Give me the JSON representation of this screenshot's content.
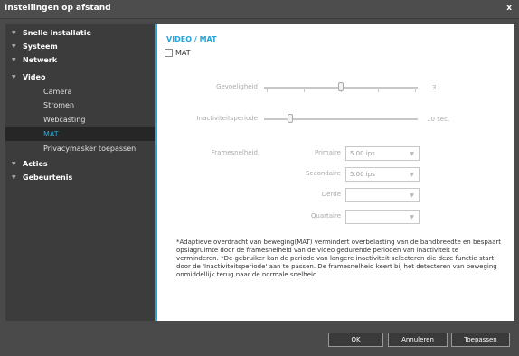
{
  "window": {
    "title": "Instellingen op afstand",
    "close": "x"
  },
  "sidebar": {
    "items": [
      {
        "label": "Snelle installatie",
        "arrow": "▼"
      },
      {
        "label": "Systeem",
        "arrow": "▼"
      },
      {
        "label": "Netwerk",
        "arrow": "▼"
      },
      {
        "label": "Video",
        "arrow": "▼"
      },
      {
        "label": "Camera"
      },
      {
        "label": "Stromen"
      },
      {
        "label": "Webcasting"
      },
      {
        "label": "MAT"
      },
      {
        "label": "Privacymasker toepassen"
      },
      {
        "label": "Acties",
        "arrow": "▼"
      },
      {
        "label": "Gebeurtenis",
        "arrow": "▼"
      }
    ]
  },
  "main": {
    "section_title": "VIDEO / MAT",
    "mat_checkbox": {
      "label": "MAT",
      "checked": false
    },
    "sensitivity": {
      "label": "Gevoeligheid",
      "value": "3",
      "level": 3,
      "max": 5
    },
    "inactivity": {
      "label": "Inactiviteitsperiode",
      "value": "10",
      "unit": "sec.",
      "level": 0.17
    },
    "framerate": {
      "label": "Framesnelheid",
      "rows": [
        {
          "label": "Primaire",
          "value": "5.00 ips"
        },
        {
          "label": "Secondaire",
          "value": "5.00 ips"
        },
        {
          "label": "Derde",
          "value": ""
        },
        {
          "label": "Quartaire",
          "value": ""
        }
      ]
    },
    "note": "*Adaptieve overdracht van beweging(MAT) vermindert overbelasting van de bandbreedte en bespaart opslagruimte door de framesnelheid van de video gedurende perioden van inactiviteit te verminderen. *De gebruiker kan de periode van langere inactiviteit selecteren die deze functie start door de 'Inactiviteitsperiode' aan te passen. De framesnelheid keert bij het detecteren van beweging onmiddellijk terug naar de normale snelheid."
  },
  "footer": {
    "ok": "OK",
    "cancel": "Annuleren",
    "apply": "Toepassen"
  },
  "colors": {
    "accent": "#27a4d8",
    "sidebar": "#3c3c3c",
    "window": "#4a4a4a"
  }
}
